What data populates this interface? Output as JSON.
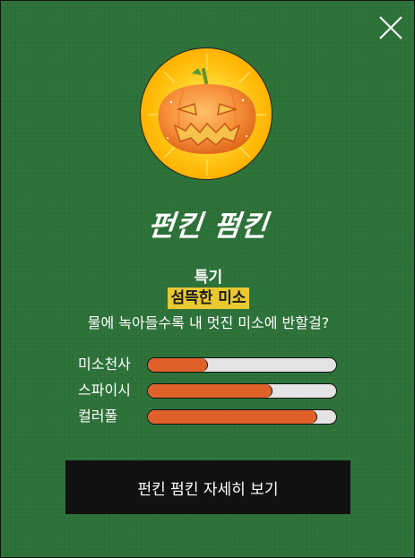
{
  "colors": {
    "background": "#2e733a",
    "bar_fill": "#e0602a",
    "bar_track": "#e4e4e4",
    "highlight": "#e9c832",
    "button": "#111111"
  },
  "close_icon": "close-icon",
  "badge_icon": "jack-o-lantern-icon",
  "title": "펀킨 펌킨",
  "trait": {
    "heading": "특기",
    "name": "섬뜩한 미소",
    "description": "물에 녹아들수록 내 멋진 미소에 반할걸?"
  },
  "stats": [
    {
      "label": "미소천사",
      "value": 0.32
    },
    {
      "label": "스파이시",
      "value": 0.66
    },
    {
      "label": "컬러풀",
      "value": 0.9
    }
  ],
  "detail_button_label": "펀킨 펌킨 자세히 보기"
}
